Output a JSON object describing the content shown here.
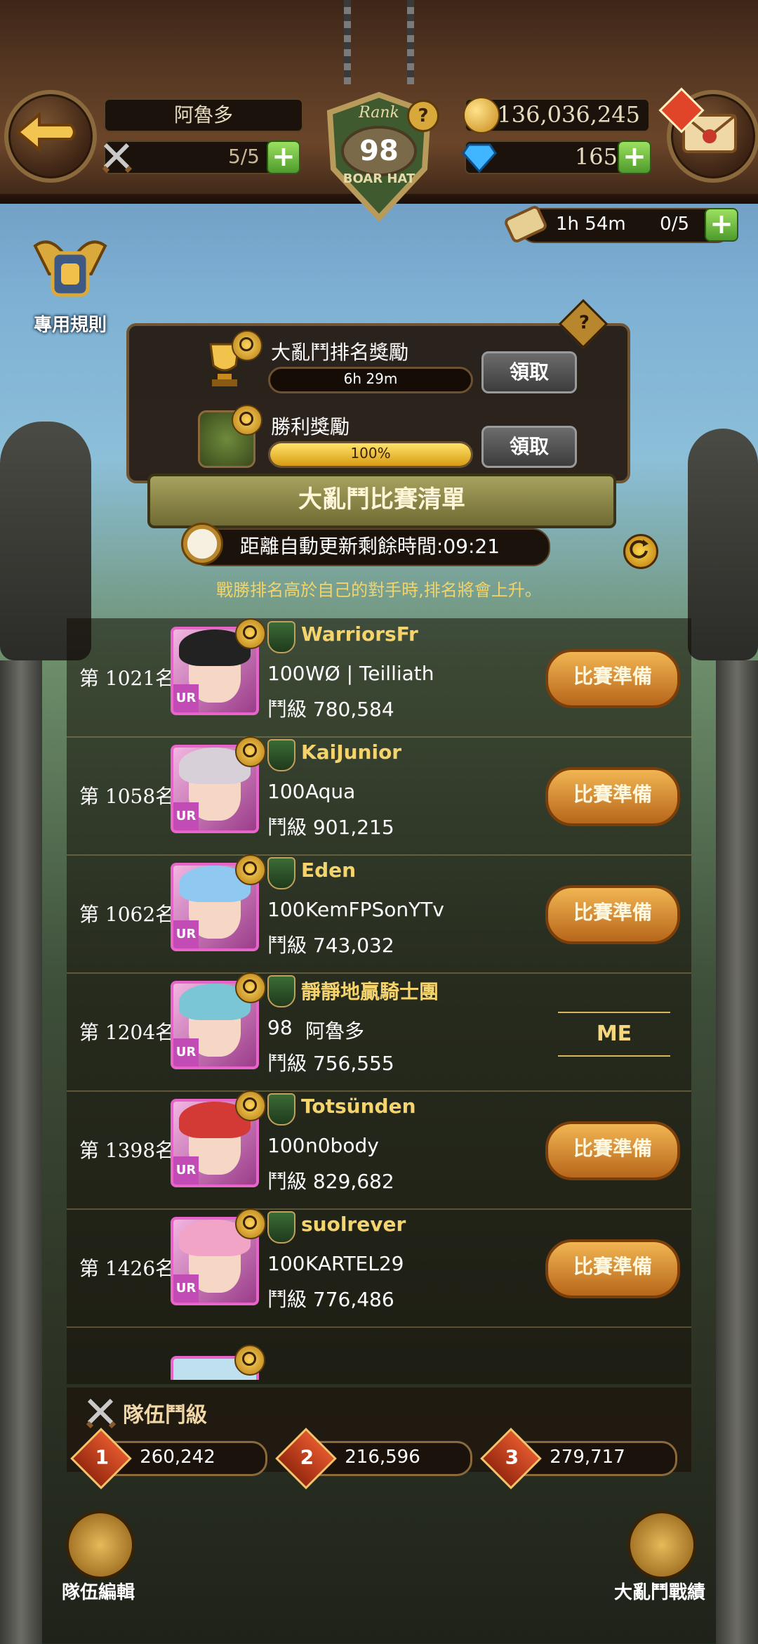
{
  "header": {
    "player_name": "阿魯多",
    "stamina": "5/5",
    "gold": "136,036,245",
    "gems": "165",
    "rank_label": "Rank",
    "rank_value": "98",
    "rank_sub": "BOAR HAT",
    "timer": "1h 54m",
    "timer_count": "0/5"
  },
  "side": {
    "rules_label": "專用規則"
  },
  "rewards": [
    {
      "title": "大亂鬥排名獎勵",
      "bar_text": "6h 29m",
      "fill": 0,
      "button": "領取"
    },
    {
      "title": "勝利獎勵",
      "bar_text": "100%",
      "fill": 1.0,
      "button": "領取"
    }
  ],
  "list_title": "大亂鬥比賽清單",
  "refresh_text": "距離自動更新剩餘時間:09:21",
  "hint": "戰勝排名高於自己的對手時,排名將會上升。",
  "opponents": [
    {
      "rank": "第 1021名",
      "guild": "WarriorsFr",
      "level": "100",
      "name": "WØ | Teilliath",
      "power": "鬥級 780,584",
      "action": "比賽準備",
      "hair": "#222",
      "border": "#e765c8"
    },
    {
      "rank": "第 1058名",
      "guild": "KaiJunior",
      "level": "100",
      "name": "Aqua",
      "power": "鬥級 901,215",
      "action": "比賽準備",
      "hair": "#d8d0d8",
      "border": "#e765c8"
    },
    {
      "rank": "第 1062名",
      "guild": "Eden",
      "level": "100",
      "name": "KemFPSonYTv",
      "power": "鬥級 743,032",
      "action": "比賽準備",
      "hair": "#8fc8f0",
      "border": "#e765c8"
    },
    {
      "rank": "第 1204名",
      "guild": "靜靜地贏騎士團",
      "level": "98",
      "name": "阿魯多",
      "power": "鬥級 756,555",
      "action": "ME",
      "hair": "#7bc6d6",
      "border": "#e765c8"
    },
    {
      "rank": "第 1398名",
      "guild": "Totsünden",
      "level": "100",
      "name": "n0body",
      "power": "鬥級 829,682",
      "action": "比賽準備",
      "hair": "#d33a36",
      "border": "#e765c8"
    },
    {
      "rank": "第 1426名",
      "guild": "suolrever",
      "level": "100",
      "name": "KARTEL29",
      "power": "鬥級 776,486",
      "action": "比賽準備",
      "hair": "#f2a4c6",
      "border": "#e765c8"
    }
  ],
  "team": {
    "label": "隊伍鬥級",
    "slots": [
      {
        "num": "1",
        "value": "260,242"
      },
      {
        "num": "2",
        "value": "216,596"
      },
      {
        "num": "3",
        "value": "279,717"
      }
    ]
  },
  "bottom": {
    "left_label": "隊伍編輯",
    "right_label": "大亂鬥戰績"
  },
  "icons": [
    "back-arrow-icon",
    "swords-icon",
    "gold-coin-icon",
    "gem-icon",
    "mail-icon",
    "scroll-icon",
    "fist-icon",
    "trophy-icon",
    "help-icon",
    "refresh-icon",
    "magnify-icon"
  ]
}
